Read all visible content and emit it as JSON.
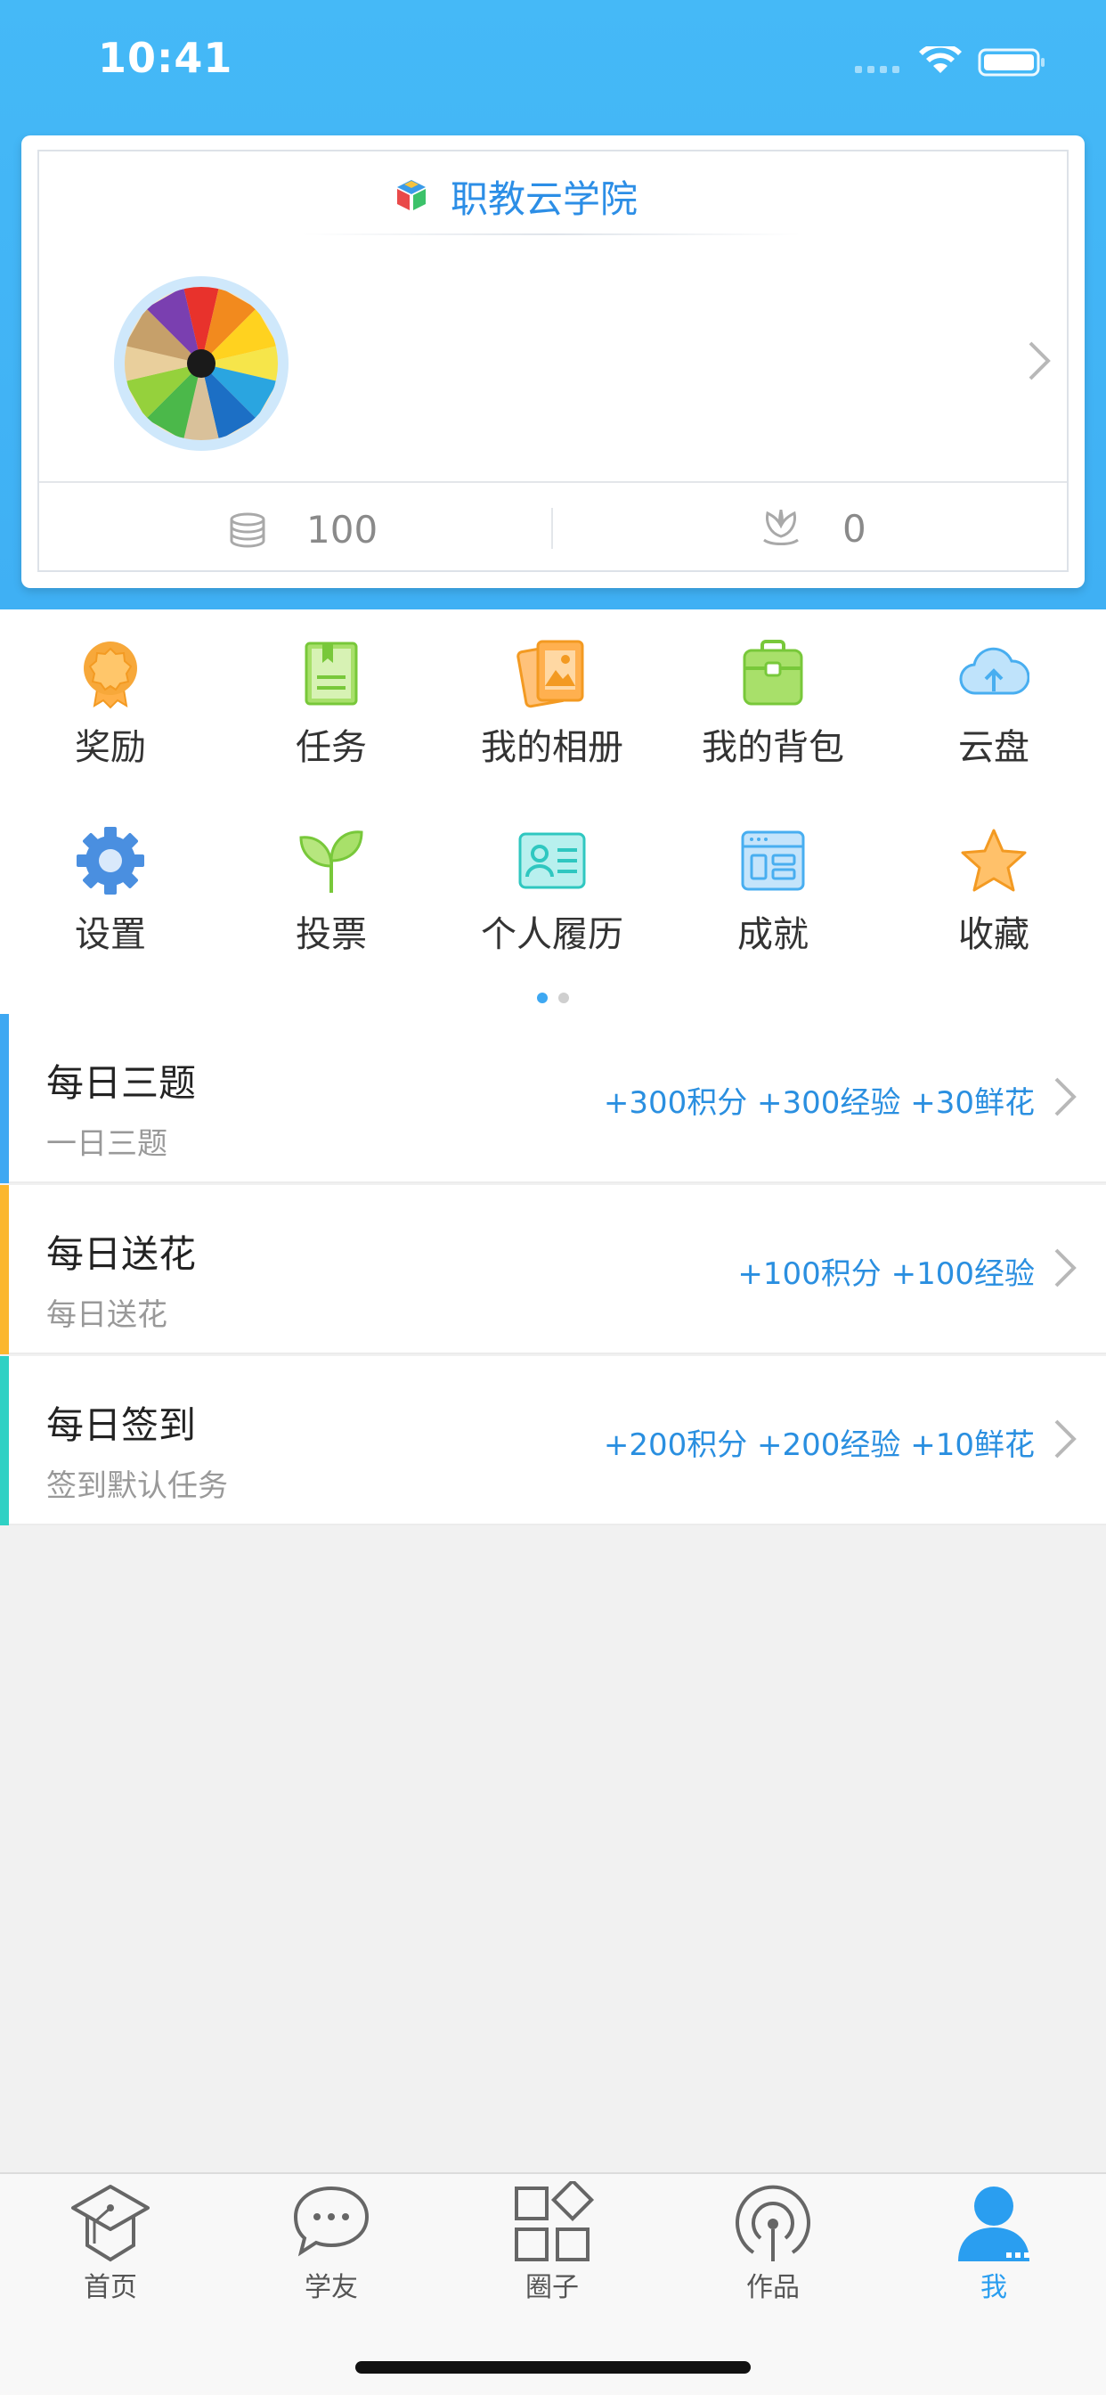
{
  "status_bar": {
    "time": "10:41"
  },
  "profile_card": {
    "school_name": "职教云学院",
    "stats": {
      "coins": "100",
      "flowers": "0"
    }
  },
  "menu": [
    {
      "label": "奖励",
      "icon": "medal-icon"
    },
    {
      "label": "任务",
      "icon": "task-book-icon"
    },
    {
      "label": "我的相册",
      "icon": "photo-album-icon"
    },
    {
      "label": "我的背包",
      "icon": "backpack-icon"
    },
    {
      "label": "云盘",
      "icon": "cloud-upload-icon"
    },
    {
      "label": "设置",
      "icon": "gear-icon"
    },
    {
      "label": "投票",
      "icon": "sprout-icon"
    },
    {
      "label": "个人履历",
      "icon": "id-card-icon"
    },
    {
      "label": "成就",
      "icon": "achievement-window-icon"
    },
    {
      "label": "收藏",
      "icon": "star-icon"
    }
  ],
  "pager": {
    "total": 2,
    "active": 1
  },
  "tasks": [
    {
      "title": "每日三题",
      "subtitle": "一日三题",
      "reward": "+300积分 +300经验 +30鲜花",
      "accent": "#3ea8f2"
    },
    {
      "title": "每日送花",
      "subtitle": "每日送花",
      "reward": "+100积分 +100经验",
      "accent": "#fbb72e"
    },
    {
      "title": "每日签到",
      "subtitle": "签到默认任务",
      "reward": "+200积分 +200经验 +10鲜花",
      "accent": "#2fd1c4"
    }
  ],
  "tabs": [
    {
      "label": "首页",
      "icon": "graduation-cap-icon"
    },
    {
      "label": "学友",
      "icon": "chat-bubble-icon"
    },
    {
      "label": "圈子",
      "icon": "grid-blocks-icon"
    },
    {
      "label": "作品",
      "icon": "broadcast-icon"
    },
    {
      "label": "我",
      "icon": "person-icon",
      "active": true
    }
  ],
  "colors": {
    "primary": "#3fb0f4",
    "accent_text": "#2a8fe0",
    "active_tab": "#2a9ef0"
  }
}
